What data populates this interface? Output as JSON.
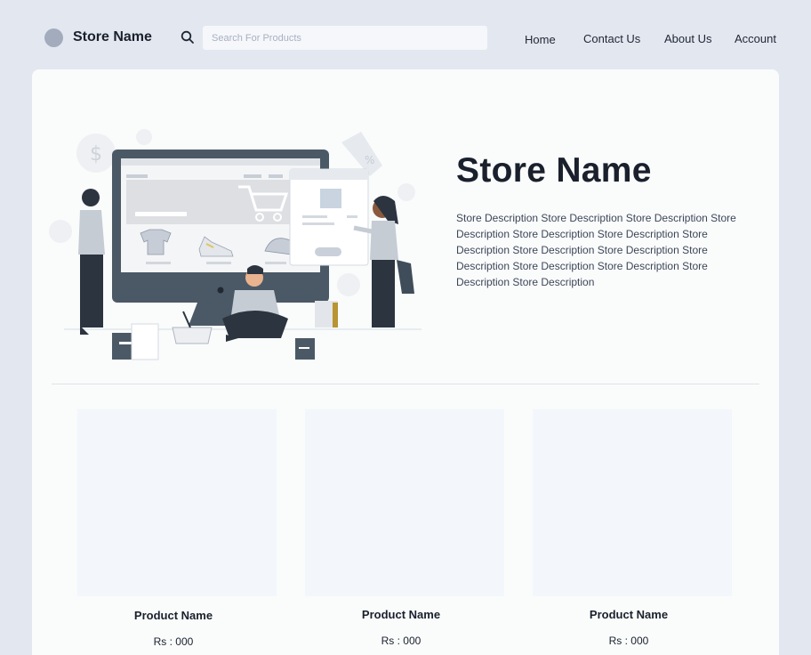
{
  "header": {
    "store_name": "Store Name",
    "search_placeholder": "Search For Products",
    "nav": [
      "Home",
      "Contact Us",
      "About Us",
      "Account"
    ]
  },
  "hero": {
    "title": "Store Name",
    "description": "Store Description Store Description Store Description Store Description Store Description Store Description  Store Description Store Description Store Description Store Description Store Description Store Description Store Description Store Description",
    "illustration": "online-shopping-illustration"
  },
  "products": [
    {
      "name": "Product Name",
      "price": "Rs : 000"
    },
    {
      "name": "Product Name",
      "price": "Rs : 000"
    },
    {
      "name": "Product Name",
      "price": "Rs : 000"
    }
  ],
  "colors": {
    "page_bg": "#e3e8f0",
    "card_bg": "#fafcfc",
    "placeholder_bg": "#f3f6fa",
    "logo_dot": "#a3acbd",
    "text_dark": "#1a202c"
  }
}
